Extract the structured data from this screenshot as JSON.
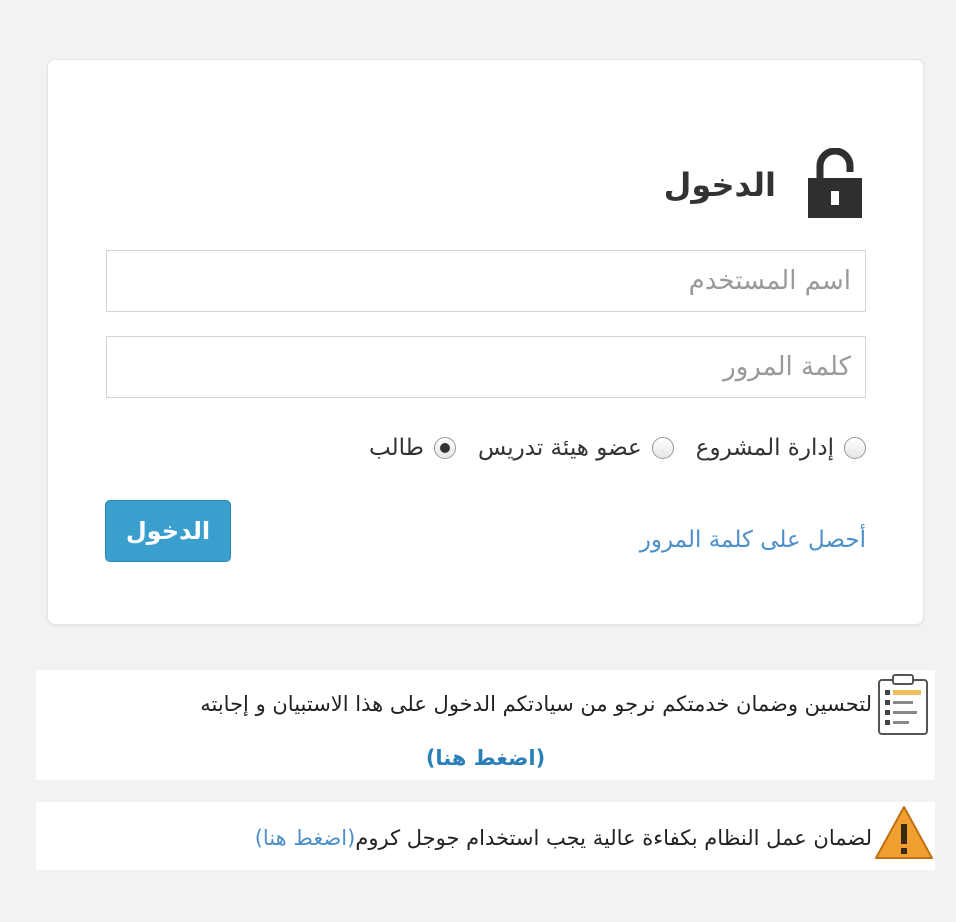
{
  "login": {
    "title": "الدخول",
    "username_placeholder": "اسم المستخدم",
    "password_placeholder": "كلمة المرور",
    "roles": [
      {
        "label": "إدارة المشروع",
        "checked": false
      },
      {
        "label": "عضو هيئة تدريس",
        "checked": false
      },
      {
        "label": "طالب",
        "checked": true
      }
    ],
    "submit_label": "الدخول",
    "forgot_password_link": "أحصل على كلمة المرور"
  },
  "notices": {
    "survey_text": "لتحسين وضمان خدمتكم نرجو من سيادتكم الدخول على هذا الاستبيان و إجابته",
    "survey_link": "(اضغط هنا)",
    "browser_text": "لضمان عمل النظام بكفاءة عالية يجب استخدام جوجل كروم",
    "browser_link": "(اضغط هنا)"
  },
  "icons": {
    "login": "lock-icon",
    "survey": "checklist-icon",
    "warning": "warning-icon"
  },
  "colors": {
    "primary_button": "#3a9fcc",
    "link": "#4d8fc9",
    "warning": "#f0a030"
  }
}
